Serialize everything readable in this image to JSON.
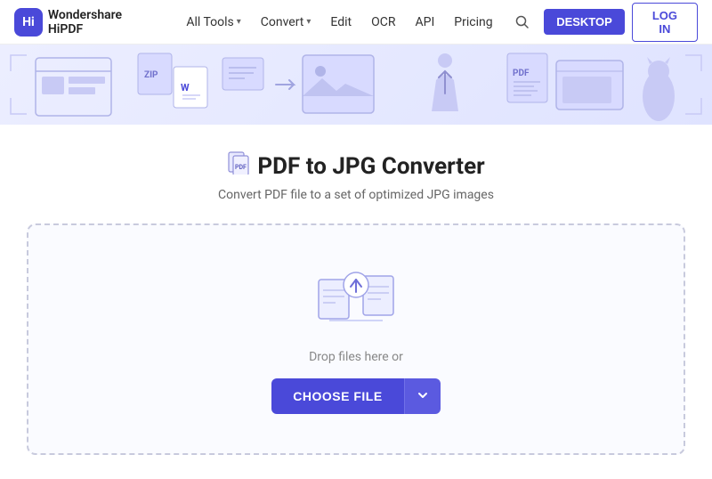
{
  "brand": {
    "logo_text": "Wondershare HiPDF",
    "logo_abbr": "Hi"
  },
  "navbar": {
    "all_tools": "All Tools",
    "convert": "Convert",
    "edit": "Edit",
    "ocr": "OCR",
    "api": "API",
    "pricing": "Pricing",
    "desktop_btn": "DESKTOP",
    "login_btn": "LOG IN"
  },
  "page": {
    "title": "PDF to JPG Converter",
    "subtitle": "Convert PDF file to a set of optimized JPG images",
    "drop_text": "Drop files here or",
    "choose_file": "CHOOSE FILE"
  },
  "colors": {
    "accent": "#4A49D9",
    "accent_light": "#eceeff"
  }
}
